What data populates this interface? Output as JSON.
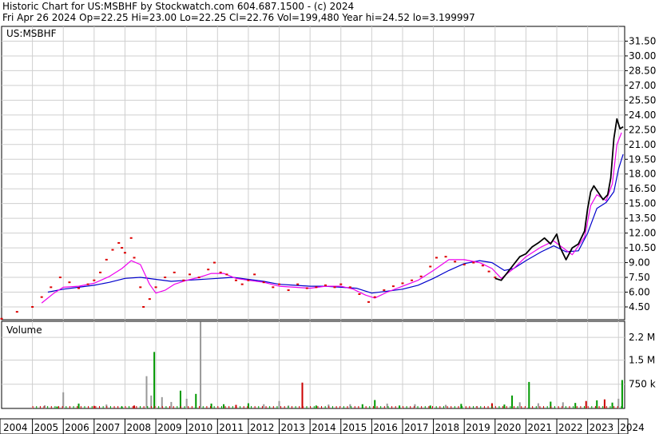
{
  "header": {
    "line1": "Historic Chart for US:MSBHF by Stockwatch.com 604.687.1500 - (c) 2024",
    "line2": "Fri Apr 26 2024   Op=22.25   Hi=23.00   Lo=22.25   Cl=22.76   Vol=199,480   Year hi=24.52   lo=3.199997"
  },
  "chart_data": [
    {
      "type": "line",
      "symbol_label": "US:MSBHF",
      "grid": true,
      "y_ticks": [
        "31.50",
        "30.00",
        "28.50",
        "27.00",
        "25.50",
        "24.00",
        "22.50",
        "21.00",
        "19.50",
        "18.00",
        "16.50",
        "15.00",
        "13.50",
        "12.00",
        "10.50",
        "9.00",
        "7.50",
        "6.00",
        "4.50"
      ],
      "ylim": [
        3.2,
        33.0
      ],
      "x_labels": [
        "2004",
        "2005",
        "2006",
        "2007",
        "2008",
        "2009",
        "2010",
        "2011",
        "2012",
        "2013",
        "2014",
        "2015",
        "2016",
        "2017",
        "2018",
        "2019",
        "2020",
        "2021",
        "2022",
        "2023",
        "2024"
      ],
      "colors": {
        "price": "#dd0000",
        "recent": "#000000",
        "ma_short": "#ee00ee",
        "ma_long": "#0000cc"
      },
      "series": [
        {
          "key": "price",
          "values": [
            [
              2004.0,
              3.3
            ],
            [
              2004.5,
              4.0
            ],
            [
              2005.0,
              4.5
            ],
            [
              2005.3,
              5.5
            ],
            [
              2005.6,
              6.5
            ],
            [
              2005.9,
              7.5
            ],
            [
              2006.2,
              7.0
            ],
            [
              2006.5,
              6.4
            ],
            [
              2006.8,
              6.8
            ],
            [
              2007.0,
              7.2
            ],
            [
              2007.2,
              8.0
            ],
            [
              2007.4,
              9.3
            ],
            [
              2007.6,
              10.3
            ],
            [
              2007.8,
              11.0
            ],
            [
              2007.9,
              10.5
            ],
            [
              2008.0,
              10.0
            ],
            [
              2008.2,
              11.5
            ],
            [
              2008.3,
              9.5
            ],
            [
              2008.5,
              6.5
            ],
            [
              2008.6,
              4.5
            ],
            [
              2008.8,
              5.3
            ],
            [
              2009.0,
              6.5
            ],
            [
              2009.3,
              7.5
            ],
            [
              2009.6,
              8.0
            ],
            [
              2009.9,
              7.2
            ],
            [
              2010.1,
              7.8
            ],
            [
              2010.4,
              7.5
            ],
            [
              2010.7,
              8.3
            ],
            [
              2010.9,
              9.0
            ],
            [
              2011.1,
              8.0
            ],
            [
              2011.3,
              7.8
            ],
            [
              2011.6,
              7.2
            ],
            [
              2011.8,
              6.8
            ],
            [
              2012.0,
              7.2
            ],
            [
              2012.2,
              7.8
            ],
            [
              2012.5,
              7.0
            ],
            [
              2012.8,
              6.5
            ],
            [
              2013.0,
              6.8
            ],
            [
              2013.3,
              6.2
            ],
            [
              2013.6,
              6.8
            ],
            [
              2013.9,
              6.4
            ],
            [
              2014.2,
              6.5
            ],
            [
              2014.5,
              6.7
            ],
            [
              2014.8,
              6.5
            ],
            [
              2015.0,
              6.8
            ],
            [
              2015.3,
              6.5
            ],
            [
              2015.6,
              5.8
            ],
            [
              2015.9,
              5.0
            ],
            [
              2016.1,
              5.5
            ],
            [
              2016.4,
              6.2
            ],
            [
              2016.7,
              6.6
            ],
            [
              2017.0,
              6.9
            ],
            [
              2017.3,
              7.2
            ],
            [
              2017.6,
              7.6
            ],
            [
              2017.9,
              8.6
            ],
            [
              2018.1,
              9.5
            ],
            [
              2018.4,
              9.6
            ],
            [
              2018.7,
              9.1
            ],
            [
              2019.0,
              8.8
            ],
            [
              2019.3,
              9.0
            ],
            [
              2019.6,
              8.7
            ],
            [
              2019.8,
              8.1
            ],
            [
              2020.0,
              7.5
            ]
          ]
        },
        {
          "key": "recent",
          "values": [
            [
              2020.0,
              7.4
            ],
            [
              2020.2,
              7.2
            ],
            [
              2020.4,
              8.0
            ],
            [
              2020.6,
              8.8
            ],
            [
              2020.8,
              9.6
            ],
            [
              2021.0,
              9.9
            ],
            [
              2021.2,
              10.6
            ],
            [
              2021.4,
              11.0
            ],
            [
              2021.6,
              11.5
            ],
            [
              2021.8,
              10.9
            ],
            [
              2022.0,
              11.9
            ],
            [
              2022.1,
              10.6
            ],
            [
              2022.3,
              9.3
            ],
            [
              2022.5,
              10.5
            ],
            [
              2022.7,
              10.9
            ],
            [
              2022.9,
              12.2
            ],
            [
              2023.0,
              14.5
            ],
            [
              2023.1,
              16.2
            ],
            [
              2023.2,
              16.8
            ],
            [
              2023.35,
              16.1
            ],
            [
              2023.5,
              15.4
            ],
            [
              2023.65,
              15.9
            ],
            [
              2023.75,
              17.6
            ],
            [
              2023.85,
              21.6
            ],
            [
              2023.95,
              23.6
            ],
            [
              2024.05,
              22.6
            ],
            [
              2024.15,
              22.8
            ]
          ]
        },
        {
          "key": "ma_short",
          "values": [
            [
              2005.3,
              4.9
            ],
            [
              2005.7,
              5.9
            ],
            [
              2006.0,
              6.5
            ],
            [
              2006.5,
              6.6
            ],
            [
              2007.0,
              6.9
            ],
            [
              2007.5,
              7.6
            ],
            [
              2007.9,
              8.4
            ],
            [
              2008.2,
              9.2
            ],
            [
              2008.5,
              8.8
            ],
            [
              2008.8,
              6.8
            ],
            [
              2009.0,
              5.9
            ],
            [
              2009.3,
              6.2
            ],
            [
              2009.6,
              6.8
            ],
            [
              2010.0,
              7.2
            ],
            [
              2010.4,
              7.5
            ],
            [
              2010.8,
              7.9
            ],
            [
              2011.2,
              7.9
            ],
            [
              2011.6,
              7.4
            ],
            [
              2012.0,
              7.2
            ],
            [
              2012.5,
              7.0
            ],
            [
              2013.0,
              6.6
            ],
            [
              2013.5,
              6.5
            ],
            [
              2014.0,
              6.4
            ],
            [
              2014.5,
              6.6
            ],
            [
              2015.0,
              6.6
            ],
            [
              2015.4,
              6.3
            ],
            [
              2015.8,
              5.7
            ],
            [
              2016.1,
              5.4
            ],
            [
              2016.5,
              6.0
            ],
            [
              2017.0,
              6.6
            ],
            [
              2017.5,
              7.2
            ],
            [
              2018.0,
              8.2
            ],
            [
              2018.5,
              9.3
            ],
            [
              2019.0,
              9.3
            ],
            [
              2019.5,
              9.0
            ],
            [
              2019.9,
              8.4
            ],
            [
              2020.2,
              7.4
            ],
            [
              2020.6,
              8.4
            ],
            [
              2021.0,
              9.6
            ],
            [
              2021.5,
              10.6
            ],
            [
              2021.9,
              11.2
            ],
            [
              2022.2,
              10.5
            ],
            [
              2022.5,
              9.8
            ],
            [
              2022.9,
              11.6
            ],
            [
              2023.1,
              14.8
            ],
            [
              2023.3,
              15.9
            ],
            [
              2023.6,
              15.3
            ],
            [
              2023.8,
              17.0
            ],
            [
              2023.95,
              21.0
            ],
            [
              2024.1,
              22.2
            ]
          ]
        },
        {
          "key": "ma_long",
          "values": [
            [
              2005.5,
              6.0
            ],
            [
              2006.0,
              6.3
            ],
            [
              2006.5,
              6.5
            ],
            [
              2007.0,
              6.7
            ],
            [
              2007.5,
              7.0
            ],
            [
              2008.0,
              7.4
            ],
            [
              2008.5,
              7.5
            ],
            [
              2009.0,
              7.3
            ],
            [
              2009.5,
              7.1
            ],
            [
              2010.0,
              7.2
            ],
            [
              2010.5,
              7.3
            ],
            [
              2011.0,
              7.4
            ],
            [
              2011.5,
              7.5
            ],
            [
              2012.0,
              7.3
            ],
            [
              2012.5,
              7.1
            ],
            [
              2013.0,
              6.8
            ],
            [
              2013.5,
              6.7
            ],
            [
              2014.0,
              6.6
            ],
            [
              2014.5,
              6.6
            ],
            [
              2015.0,
              6.5
            ],
            [
              2015.5,
              6.4
            ],
            [
              2016.0,
              5.9
            ],
            [
              2016.5,
              6.1
            ],
            [
              2017.0,
              6.3
            ],
            [
              2017.5,
              6.7
            ],
            [
              2018.0,
              7.4
            ],
            [
              2018.5,
              8.2
            ],
            [
              2019.0,
              8.9
            ],
            [
              2019.5,
              9.2
            ],
            [
              2019.9,
              9.0
            ],
            [
              2020.3,
              8.2
            ],
            [
              2020.6,
              8.4
            ],
            [
              2021.0,
              9.2
            ],
            [
              2021.5,
              10.1
            ],
            [
              2021.9,
              10.7
            ],
            [
              2022.3,
              10.1
            ],
            [
              2022.7,
              10.2
            ],
            [
              2023.0,
              12.0
            ],
            [
              2023.3,
              14.5
            ],
            [
              2023.6,
              15.1
            ],
            [
              2023.85,
              16.2
            ],
            [
              2024.0,
              18.5
            ],
            [
              2024.15,
              20.0
            ]
          ]
        }
      ]
    },
    {
      "type": "bar",
      "title": "Volume",
      "y_ticks": [
        "2.2 M",
        "1.5 M",
        "750 k"
      ],
      "ylim": [
        0,
        2700000
      ],
      "colors": {
        "up": "#009900",
        "down": "#cc0000",
        "flat": "#999999"
      },
      "bars": [
        [
          2005.4,
          95000,
          "flat"
        ],
        [
          2005.8,
          60000,
          "up"
        ],
        [
          2006.0,
          500000,
          "flat"
        ],
        [
          2006.5,
          150000,
          "up"
        ],
        [
          2007.0,
          80000,
          "down"
        ],
        [
          2007.4,
          120000,
          "flat"
        ],
        [
          2007.9,
          60000,
          "up"
        ],
        [
          2008.3,
          90000,
          "down"
        ],
        [
          2008.7,
          1000000,
          "flat"
        ],
        [
          2008.85,
          400000,
          "flat"
        ],
        [
          2008.95,
          1750000,
          "up"
        ],
        [
          2009.2,
          350000,
          "flat"
        ],
        [
          2009.5,
          200000,
          "flat"
        ],
        [
          2009.8,
          550000,
          "up"
        ],
        [
          2010.0,
          300000,
          "flat"
        ],
        [
          2010.3,
          450000,
          "up"
        ],
        [
          2010.45,
          2680000,
          "flat"
        ],
        [
          2010.8,
          150000,
          "up"
        ],
        [
          2011.2,
          130000,
          "up"
        ],
        [
          2011.6,
          110000,
          "down"
        ],
        [
          2012.0,
          160000,
          "up"
        ],
        [
          2012.5,
          130000,
          "flat"
        ],
        [
          2013.0,
          230000,
          "flat"
        ],
        [
          2013.3,
          90000,
          "flat"
        ],
        [
          2013.75,
          800000,
          "down"
        ],
        [
          2014.2,
          90000,
          "up"
        ],
        [
          2014.6,
          120000,
          "flat"
        ],
        [
          2015.3,
          130000,
          "flat"
        ],
        [
          2015.7,
          130000,
          "up"
        ],
        [
          2016.1,
          260000,
          "up"
        ],
        [
          2016.5,
          150000,
          "flat"
        ],
        [
          2016.9,
          90000,
          "up"
        ],
        [
          2017.4,
          130000,
          "flat"
        ],
        [
          2017.9,
          90000,
          "up"
        ],
        [
          2018.4,
          110000,
          "flat"
        ],
        [
          2018.9,
          140000,
          "up"
        ],
        [
          2019.4,
          70000,
          "flat"
        ],
        [
          2019.9,
          160000,
          "down"
        ],
        [
          2020.3,
          120000,
          "up"
        ],
        [
          2020.55,
          400000,
          "up"
        ],
        [
          2020.8,
          190000,
          "flat"
        ],
        [
          2021.1,
          820000,
          "up"
        ],
        [
          2021.4,
          160000,
          "flat"
        ],
        [
          2021.8,
          210000,
          "up"
        ],
        [
          2022.2,
          190000,
          "flat"
        ],
        [
          2022.6,
          170000,
          "up"
        ],
        [
          2022.95,
          230000,
          "down"
        ],
        [
          2023.3,
          250000,
          "up"
        ],
        [
          2023.55,
          280000,
          "down"
        ],
        [
          2023.8,
          180000,
          "up"
        ],
        [
          2024.0,
          300000,
          "flat"
        ],
        [
          2024.12,
          880000,
          "up"
        ]
      ]
    }
  ]
}
